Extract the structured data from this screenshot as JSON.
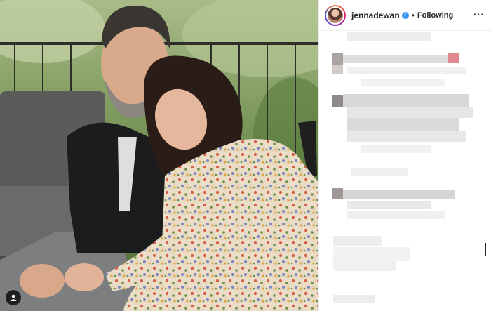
{
  "post": {
    "username": "jennadewan",
    "verified_icon": "verified-badge-icon",
    "separator": "•",
    "follow_label": "Following",
    "more_icon": "more-options-icon",
    "more_label": "···"
  },
  "photo": {
    "tag_icon": "user-tag-icon"
  },
  "comments_pixelated": true,
  "colors": {
    "header_text": "#262626",
    "verified_blue": "#3897f0",
    "divider": "#efefef",
    "pixel_gray": "#d8d8d8",
    "pixel_accent": "#e0888f"
  }
}
